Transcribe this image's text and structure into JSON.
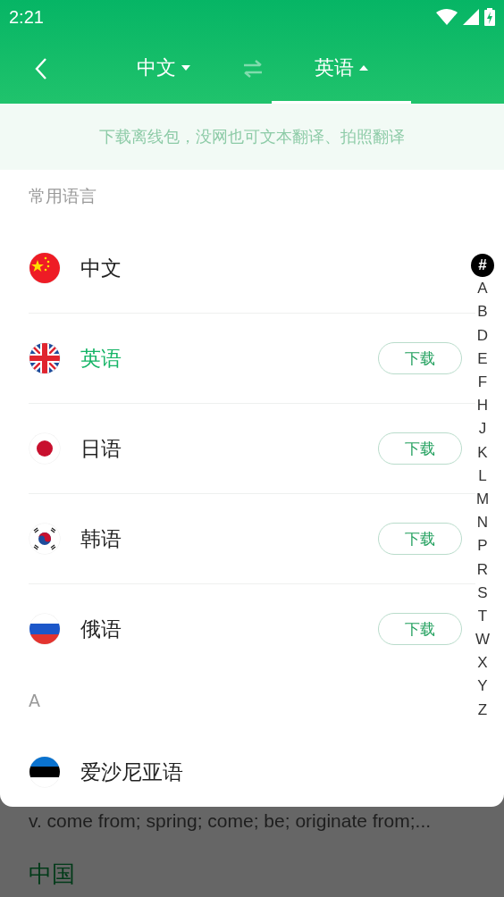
{
  "status_bar": {
    "time": "2:21"
  },
  "tabs": [
    {
      "label": "中文",
      "selected": false
    },
    {
      "label": "英语",
      "selected": true
    }
  ],
  "banner": "下载离线包，没网也可文本翻译、拍照翻译",
  "sections": [
    {
      "title": "常用语言",
      "items": [
        {
          "name": "中文",
          "kind": "china",
          "selected": false
        },
        {
          "name": "英语",
          "kind": "uk",
          "selected": true,
          "action": "下载"
        },
        {
          "name": "日语",
          "kind": "japan",
          "selected": false,
          "action": "下载"
        },
        {
          "name": "韩语",
          "kind": "korea",
          "selected": false,
          "action": "下载"
        },
        {
          "name": "俄语",
          "kind": "russia",
          "selected": false,
          "action": "下载"
        }
      ]
    },
    {
      "title": "A",
      "items": [
        {
          "name": "爱沙尼亚语",
          "kind": "estonia",
          "selected": false
        }
      ]
    }
  ],
  "index": [
    {
      "label": "#",
      "selected": true
    },
    {
      "label": "A",
      "selected": false
    },
    {
      "label": "B",
      "selected": false
    },
    {
      "label": "D",
      "selected": false
    },
    {
      "label": "E",
      "selected": false
    },
    {
      "label": "F",
      "selected": false
    },
    {
      "label": "H",
      "selected": false
    },
    {
      "label": "J",
      "selected": false
    },
    {
      "label": "K",
      "selected": false
    },
    {
      "label": "L",
      "selected": false
    },
    {
      "label": "M",
      "selected": false
    },
    {
      "label": "N",
      "selected": false
    },
    {
      "label": "P",
      "selected": false
    },
    {
      "label": "R",
      "selected": false
    },
    {
      "label": "S",
      "selected": false
    },
    {
      "label": "T",
      "selected": false
    },
    {
      "label": "W",
      "selected": false
    },
    {
      "label": "X",
      "selected": false
    },
    {
      "label": "Y",
      "selected": false
    },
    {
      "label": "Z",
      "selected": false
    }
  ],
  "background": {
    "definition": "v. come from; spring; come; be; originate from;...",
    "word": "中国"
  }
}
